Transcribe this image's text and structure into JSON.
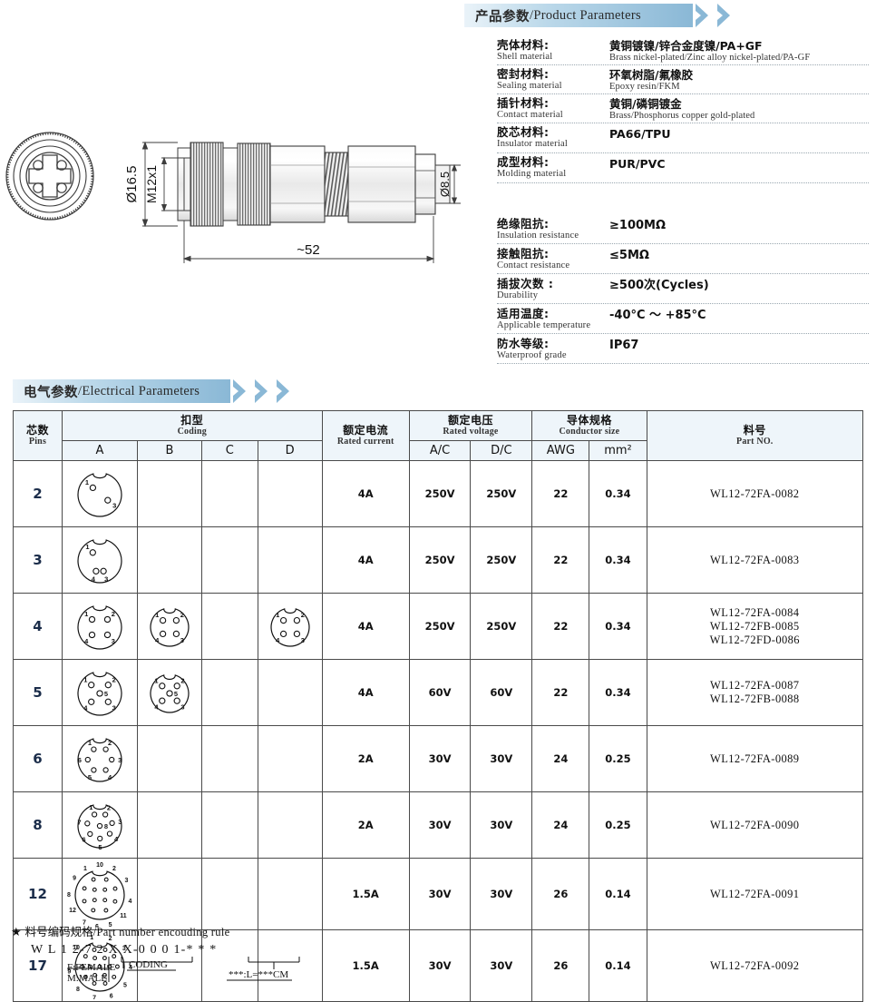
{
  "product_banner": {
    "cn": "产品参数",
    "sep": "/",
    "en": "Product Parameters"
  },
  "electrical_banner": {
    "cn": "电气参数",
    "sep": "/",
    "en": "Electrical Parameters"
  },
  "drawing": {
    "dim_diameter": "Ø16.5",
    "dim_thread": "M12x1",
    "dim_length": "~52",
    "dim_cable": "Ø8.5"
  },
  "product_params": [
    {
      "label_cn": "壳体材料:",
      "label_en": "Shell material",
      "value_cn": "黄铜镀镍/锌合金度镍/PA+GF",
      "value_en": "Brass nickel-plated/Zinc alloy nickel-plated/PA-GF"
    },
    {
      "label_cn": "密封材料:",
      "label_en": "Sealing material",
      "value_cn": "环氧树脂/氟橡胶",
      "value_en": "Epoxy resin/FKM"
    },
    {
      "label_cn": "插针材料:",
      "label_en": "Contact material",
      "value_cn": "黄铜/磷铜镀金",
      "value_en": "Brass/Phosphorus copper gold-plated"
    },
    {
      "label_cn": "胶芯材料:",
      "label_en": "Insulator material",
      "value_cn": "PA66/TPU",
      "value_en": ""
    },
    {
      "label_cn": "成型材料:",
      "label_en": "Molding material",
      "value_cn": "PUR/PVC",
      "value_en": ""
    }
  ],
  "performance_params": [
    {
      "label_cn": "绝缘阻抗:",
      "label_en": "Insulation resistance",
      "value": "≥100MΩ"
    },
    {
      "label_cn": "接触阻抗:",
      "label_en": "Contact resistance",
      "value": "≤5MΩ"
    },
    {
      "label_cn": "插拔次数 :",
      "label_en": "Durability",
      "value": "≥500次(Cycles)"
    },
    {
      "label_cn": "适用温度:",
      "label_en": "Applicable temperature",
      "value": "-40°C ～ +85°C"
    },
    {
      "label_cn": "防水等级:",
      "label_en": "Waterproof grade",
      "value": "IP67"
    }
  ],
  "table": {
    "headers": {
      "pins": {
        "cn": "芯数",
        "en": "Pins"
      },
      "coding": {
        "cn": "扣型",
        "en": "Coding"
      },
      "coding_cols": [
        "A",
        "B",
        "C",
        "D"
      ],
      "rated_current": {
        "cn": "额定电流",
        "en": "Rated current"
      },
      "rated_voltage": {
        "cn": "额定电压",
        "en": "Rated voltage"
      },
      "voltage_cols": [
        "A/C",
        "D/C"
      ],
      "conductor_size": {
        "cn": "导体规格",
        "en": "Conductor size"
      },
      "conductor_cols": [
        "AWG",
        "mm²"
      ],
      "part_no": {
        "cn": "料号",
        "en": "Part NO."
      }
    },
    "rows": [
      {
        "pins": "2",
        "coding": [
          "A",
          null,
          null,
          null
        ],
        "current": "4A",
        "ac": "250V",
        "dc": "250V",
        "awg": "22",
        "mm2": "0.34",
        "parts": [
          "WL12-72FA-0082"
        ]
      },
      {
        "pins": "3",
        "coding": [
          "A",
          null,
          null,
          null
        ],
        "current": "4A",
        "ac": "250V",
        "dc": "250V",
        "awg": "22",
        "mm2": "0.34",
        "parts": [
          "WL12-72FA-0083"
        ]
      },
      {
        "pins": "4",
        "coding": [
          "A",
          "B",
          null,
          "D"
        ],
        "current": "4A",
        "ac": "250V",
        "dc": "250V",
        "awg": "22",
        "mm2": "0.34",
        "parts": [
          "WL12-72FA-0084",
          "WL12-72FB-0085",
          "WL12-72FD-0086"
        ]
      },
      {
        "pins": "5",
        "coding": [
          "A",
          "B",
          null,
          null
        ],
        "current": "4A",
        "ac": "60V",
        "dc": "60V",
        "awg": "22",
        "mm2": "0.34",
        "parts": [
          "WL12-72FA-0087",
          "WL12-72FB-0088"
        ]
      },
      {
        "pins": "6",
        "coding": [
          "A",
          null,
          null,
          null
        ],
        "current": "2A",
        "ac": "30V",
        "dc": "30V",
        "awg": "24",
        "mm2": "0.25",
        "parts": [
          "WL12-72FA-0089"
        ]
      },
      {
        "pins": "8",
        "coding": [
          "A",
          null,
          null,
          null
        ],
        "current": "2A",
        "ac": "30V",
        "dc": "30V",
        "awg": "24",
        "mm2": "0.25",
        "parts": [
          "WL12-72FA-0090"
        ]
      },
      {
        "pins": "12",
        "coding": [
          "A",
          null,
          null,
          null
        ],
        "current": "1.5A",
        "ac": "30V",
        "dc": "30V",
        "awg": "26",
        "mm2": "0.14",
        "parts": [
          "WL12-72FA-0091"
        ]
      },
      {
        "pins": "17",
        "coding": [
          "A",
          null,
          null,
          null
        ],
        "current": "1.5A",
        "ac": "30V",
        "dc": "30V",
        "awg": "26",
        "mm2": "0.14",
        "parts": [
          "WL12-72FA-0092"
        ]
      }
    ]
  },
  "encoding_rule": {
    "star": "★",
    "title_cn": "料号编码规格",
    "title_sep": "/",
    "title_en": "Part number encouding rule",
    "code": "W L 1 2-7 2 X X-0 0 0 1-* * *",
    "note_gender": [
      "F:FEMALE",
      "M:MALE"
    ],
    "note_coding": "CODING",
    "note_length": "***:L=***CM"
  }
}
